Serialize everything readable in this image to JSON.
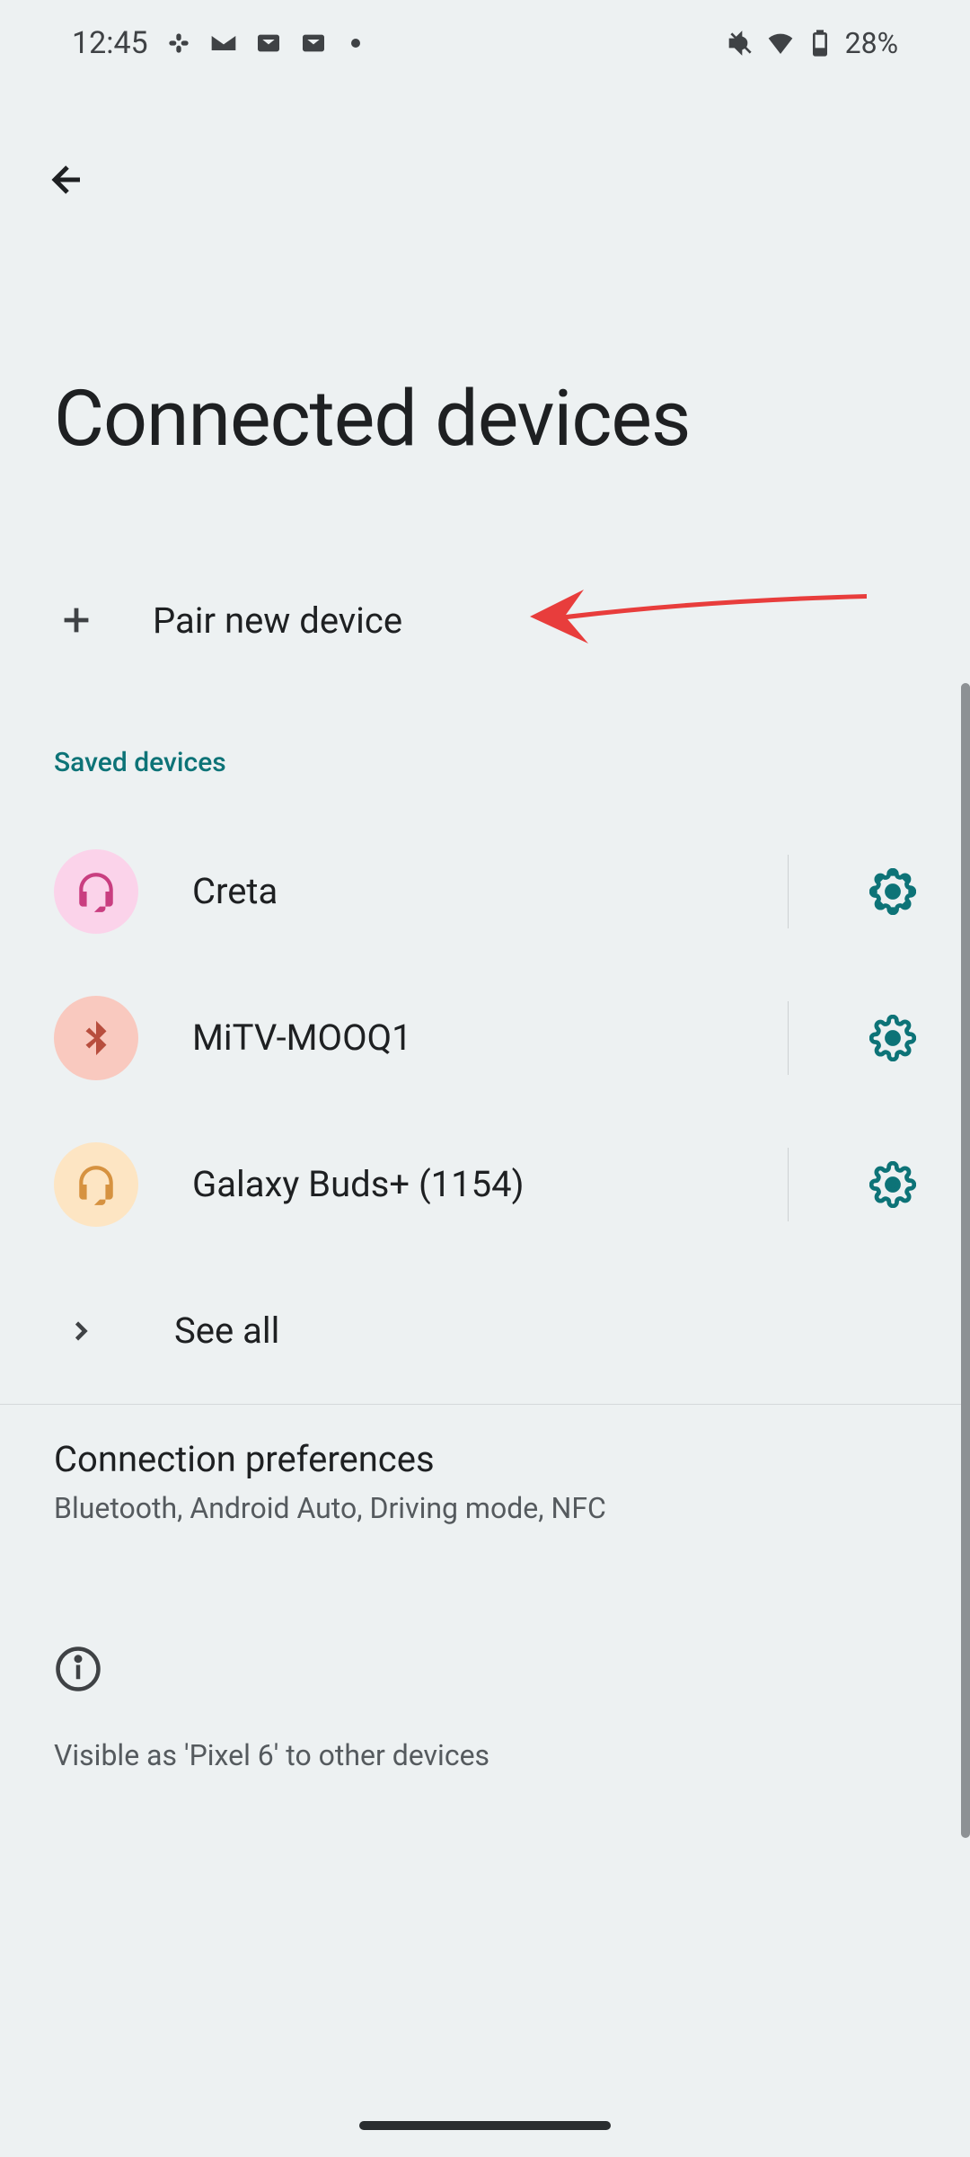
{
  "status_bar": {
    "time": "12:45",
    "battery_percent": "28%"
  },
  "header": {
    "title": "Connected devices"
  },
  "pair": {
    "label": "Pair new device"
  },
  "saved_section": {
    "header": "Saved devices",
    "devices": [
      {
        "name": "Creta",
        "icon": "headset",
        "bg_color": "#fbd3ea",
        "icon_color": "#c93e80"
      },
      {
        "name": "MiTV-MOOQ1",
        "icon": "bluetooth",
        "bg_color": "#f9c9bf",
        "icon_color": "#b84e3e"
      },
      {
        "name": "Galaxy Buds+ (1154)",
        "icon": "headset",
        "bg_color": "#fde5c3",
        "icon_color": "#d69240"
      }
    ],
    "see_all": "See all"
  },
  "connection_prefs": {
    "title": "Connection preferences",
    "subtitle": "Bluetooth, Android Auto, Driving mode, NFC"
  },
  "visibility": {
    "text": "Visible as 'Pixel 6' to other devices"
  }
}
